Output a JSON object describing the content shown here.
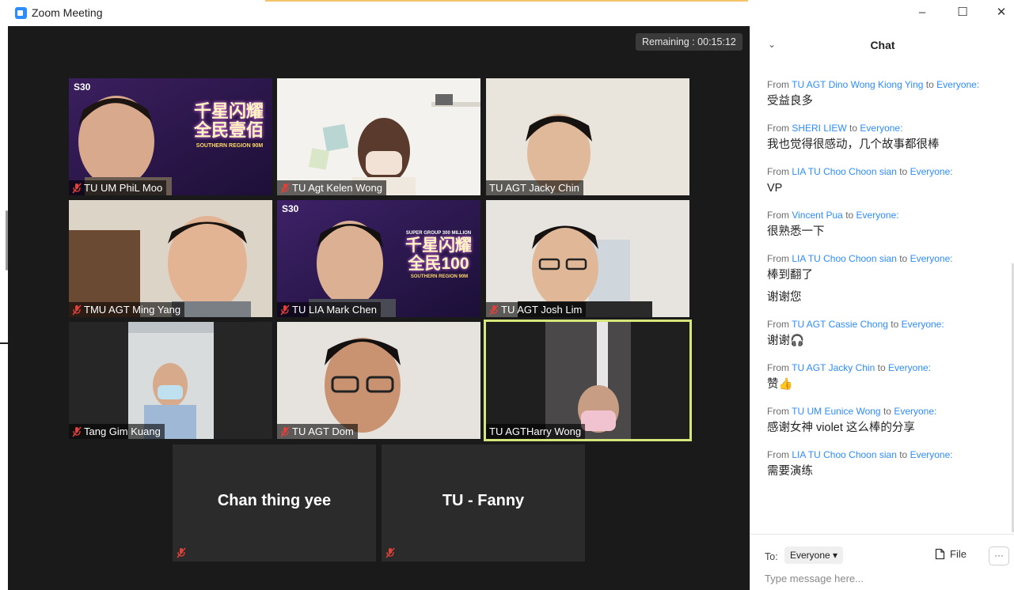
{
  "window": {
    "title": "Zoom Meeting",
    "controls": [
      "–",
      "☐",
      "✕"
    ]
  },
  "meeting": {
    "remaining": "Remaining : 00:15:12",
    "participants": [
      {
        "name": "TU UM PhiL Moo",
        "muted": true
      },
      {
        "name": "TU Agt Kelen Wong",
        "muted": true
      },
      {
        "name": "TU AGT Jacky Chin",
        "muted": false
      },
      {
        "name": "TMU AGT Ming Yang",
        "muted": true
      },
      {
        "name": "TU LIA Mark Chen",
        "muted": true
      },
      {
        "name": "TU AGT Josh Lim",
        "muted": true
      },
      {
        "name": "Tang Gim Kuang",
        "muted": true
      },
      {
        "name": "TU AGT Dom",
        "muted": true
      },
      {
        "name": "TU AGTHarry Wong",
        "muted": false,
        "active_speaker": true
      }
    ],
    "no_video": [
      {
        "name": "Chan thing yee",
        "muted": true
      },
      {
        "name": "TU - Fanny",
        "muted": true
      }
    ],
    "banner_1": "千星闪耀 全民壹佰",
    "banner_1_sub": "SOUTHERN REGION 90M",
    "banner_2": "千星闪耀 全民100",
    "banner_2_top": "SUPER GROUP 300 MILLION",
    "banner_2_sub": "SOUTHERN REGION 90M",
    "logo_mark": "S30"
  },
  "chat": {
    "header": "Chat",
    "collapse_icon": "chevron-down-icon",
    "messages": [
      {
        "from_label": "From",
        "sender": "TU AGT Dino Wong Kiong Ying",
        "to_label": "to",
        "recipient": "Everyone:",
        "lines": [
          "受益良多"
        ]
      },
      {
        "from_label": "From",
        "sender": "SHERI LIEW",
        "to_label": "to",
        "recipient": "Everyone:",
        "lines": [
          "我也觉得很感动，几个故事都很棒"
        ]
      },
      {
        "from_label": "From",
        "sender": "LIA TU Choo Choon sian",
        "to_label": "to",
        "recipient": "Everyone:",
        "lines": [
          "VP"
        ]
      },
      {
        "from_label": "From",
        "sender": "Vincent Pua",
        "to_label": "to",
        "recipient": "Everyone:",
        "lines": [
          "很熟悉一下"
        ]
      },
      {
        "from_label": "From",
        "sender": "LIA TU Choo Choon sian",
        "to_label": "to",
        "recipient": "Everyone:",
        "lines": [
          "棒到翻了",
          "谢谢您"
        ]
      },
      {
        "from_label": "From",
        "sender": "TU AGT Cassie Chong",
        "to_label": "to",
        "recipient": "Everyone:",
        "lines": [
          "谢谢🎧"
        ]
      },
      {
        "from_label": "From",
        "sender": "TU AGT Jacky Chin",
        "to_label": "to",
        "recipient": "Everyone:",
        "lines": [
          "赞👍"
        ]
      },
      {
        "from_label": "From",
        "sender": "TU UM Eunice Wong",
        "to_label": "to",
        "recipient": "Everyone:",
        "lines": [
          "感谢女神 violet 这么棒的分享"
        ]
      },
      {
        "from_label": "From",
        "sender": "LIA TU Choo Choon sian",
        "to_label": "to",
        "recipient": "Everyone:",
        "lines": [
          "需要演练"
        ]
      }
    ],
    "to_label": "To:",
    "to_value": "Everyone",
    "file_label": "File",
    "more_label": "···",
    "input_placeholder": "Type message here..."
  },
  "colors": {
    "accent": "#2d8cff",
    "active_speaker_border": "#d6e67a",
    "muted_icon": "#e0413a",
    "stage_bg": "#1a1a1a"
  }
}
